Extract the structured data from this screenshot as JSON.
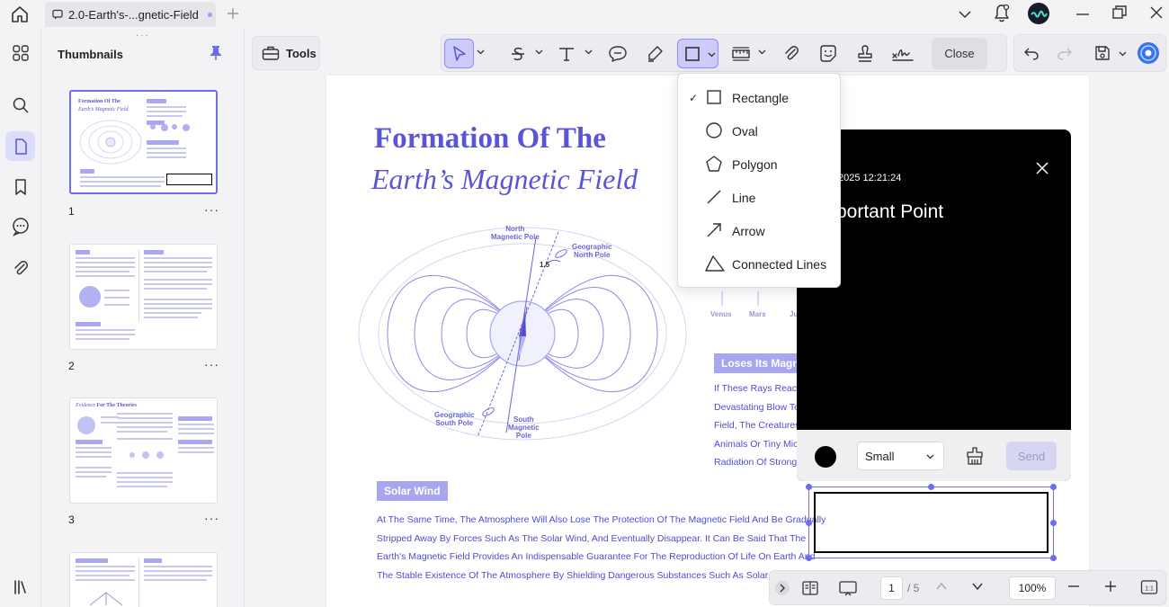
{
  "tab": {
    "title": "2.0-Earth's-...gnetic-Field"
  },
  "panel": {
    "title": "Thumbnails",
    "pages": [
      {
        "number": "1"
      },
      {
        "number": "2"
      },
      {
        "number": "3"
      }
    ],
    "more": "···"
  },
  "toolbar": {
    "tools_label": "Tools",
    "close_label": "Close"
  },
  "shape_menu": {
    "checked": "✓",
    "items": [
      {
        "label": "Rectangle",
        "icon": "rectangle-icon"
      },
      {
        "label": "Oval",
        "icon": "oval-icon"
      },
      {
        "label": "Polygon",
        "icon": "polygon-icon"
      },
      {
        "label": "Line",
        "icon": "line-icon"
      },
      {
        "label": "Arrow",
        "icon": "arrow-icon"
      },
      {
        "label": "Connected Lines",
        "icon": "connected-lines-icon"
      }
    ]
  },
  "document": {
    "title_line1": "Formation Of The",
    "title_line2": "Earth’s Magnetic Field",
    "diagram_labels": {
      "north_magnetic_pole": "North\nMagnetic Pole",
      "geographic_north_pole": "Geographic\nNorth Pole",
      "angle": "1.5",
      "geographic_south_pole": "Geographic\nSouth Pole",
      "south_magnetic_pole": "South\nMagnetic\nPole"
    },
    "planets": [
      "Venus",
      "Mars",
      "Ju"
    ],
    "section_right_heading": "Loses Its Magne",
    "section_right_lines": [
      "If These Rays Reach",
      "Devastating Blow To",
      "Field, The Creatures",
      "Animals Or Tiny Micro",
      "Radiation Of Strong F"
    ],
    "solar_wind_heading": "Solar Wind",
    "solar_wind_lines": [
      "At The Same Time, The Atmosphere Will Also Lose The Protection Of The Magnetic Field And Be Gradually",
      "Stripped Away By Forces Such As The Solar Wind, And Eventually Disappear. It Can Be Said That The",
      "Earth's Magnetic Field Provides An Indispensable Guarantee For The Reproduction Of Life On Earth And",
      "The Stable Existence Of The Atmosphere By Shielding Dangerous Substances Such As Solar Particle"
    ]
  },
  "comment": {
    "timestamp": "2025 12:21:24",
    "text": "portant Point",
    "size_value": "Small",
    "send_label": "Send"
  },
  "bottom_bar": {
    "current_page": "1",
    "total_pages": "/ 5",
    "zoom": "100%"
  },
  "colors": {
    "accent": "#6f6cf0",
    "heading": "#5a55d8",
    "pill": "#a9a6f0"
  }
}
